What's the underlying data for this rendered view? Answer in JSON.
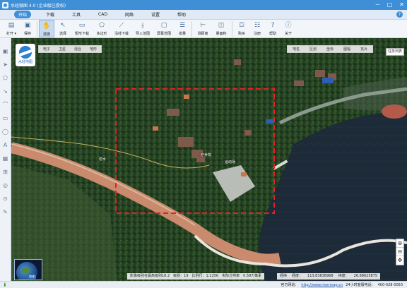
{
  "window": {
    "title": "水经微图 4.0 (企业版已授权)",
    "controls": [
      "－",
      "□",
      "✕"
    ]
  },
  "menu": [
    "开始",
    "下载",
    "工具",
    "CAD",
    "网络",
    "设置",
    "帮助"
  ],
  "toolbar": [
    {
      "label": "打开 ▾",
      "icon": "folder-icon",
      "glyph": "▤"
    },
    {
      "label": "保存",
      "icon": "save-icon",
      "glyph": "▣"
    },
    {
      "label": "漫游",
      "icon": "hand-icon",
      "glyph": "✋"
    },
    {
      "label": "选择",
      "icon": "pointer-icon",
      "glyph": "↖"
    },
    {
      "label": "矩形下载",
      "icon": "rect-download-icon",
      "glyph": "▭"
    },
    {
      "label": "多边形",
      "icon": "polygon-icon",
      "glyph": "⬠"
    },
    {
      "label": "沿线下载",
      "icon": "line-download-icon",
      "glyph": "⟋"
    },
    {
      "label": "导入范围",
      "icon": "import-range-icon",
      "glyph": "⤓"
    },
    {
      "label": "屏幕范围",
      "icon": "screen-range-icon",
      "glyph": "▢"
    },
    {
      "label": "批量",
      "icon": "batch-icon",
      "glyph": "☰"
    },
    {
      "label": "测距离",
      "icon": "measure-distance-icon",
      "glyph": "⊢"
    },
    {
      "label": "量面积",
      "icon": "measure-area-icon",
      "glyph": "◫"
    },
    {
      "label": "购买",
      "icon": "cart-icon",
      "glyph": "⛋"
    },
    {
      "label": "注册",
      "icon": "register-icon",
      "glyph": "☷"
    },
    {
      "label": "帮助",
      "icon": "help-icon",
      "glyph": "?"
    },
    {
      "label": "关于",
      "icon": "about-icon",
      "glyph": "ⓘ"
    }
  ],
  "left_tools": [
    "▣",
    "➤",
    "⬠",
    "↘",
    "⌒",
    "▭",
    "◯",
    "A",
    "▦",
    "⊞",
    "◎",
    "⊙",
    "✎"
  ],
  "map": {
    "logo_label": "水经地图",
    "map_types": [
      "电子",
      "卫星",
      "混合",
      "地形"
    ],
    "overlay_tabs": [
      "地名",
      "区划",
      "坐标",
      "图幅",
      "瓦片"
    ],
    "task_list_label": "任务列表",
    "place_labels": [
      "疗养院",
      "运动场",
      "碧水"
    ],
    "zoom_buttons": [
      "⊕",
      "⊖",
      "✥"
    ],
    "minimap_label": "地球"
  },
  "scale_info": {
    "level": "影像级别在最高级别18.2",
    "zoom": "级别：19",
    "ratio": "比例尺：1:2256",
    "zoom_percent": "实际分辨率",
    "resolution": "0.587/像素"
  },
  "coords": {
    "label": "经纬",
    "longitude_label": "经度：",
    "longitude": "113.83838968",
    "latitude_label": "纬度：",
    "latitude": "26.88625875"
  },
  "status": {
    "site_label": "官方网站：",
    "site_url": "http://www.rivermap.cn",
    "hotline": "24小时客服电话：",
    "phone": "400-028-0050"
  }
}
